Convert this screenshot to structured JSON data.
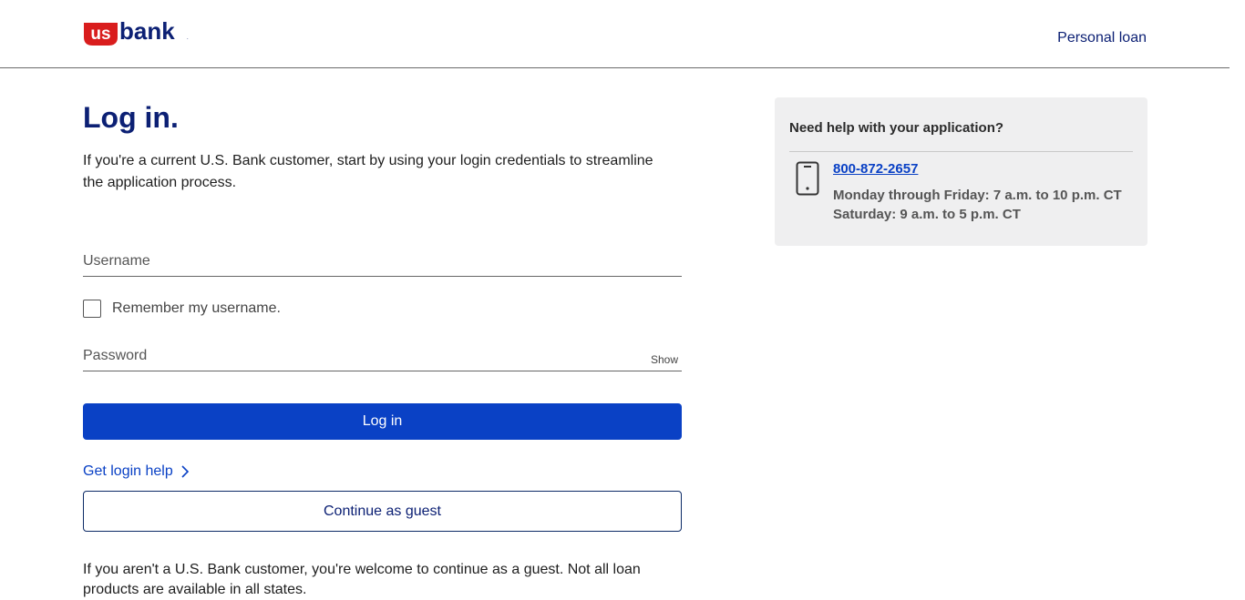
{
  "header": {
    "logo_text": "usbank",
    "nav_link": "Personal loan",
    "colors": {
      "brand_red": "#d91d1d",
      "brand_navy": "#0c2074"
    }
  },
  "main": {
    "title": "Log in.",
    "intro": "If you're a current U.S. Bank customer, start by using your login credentials to streamline the application process.",
    "username_label": "Username",
    "remember_label": "Remember my username.",
    "password_label": "Password",
    "show_label": "Show",
    "login_button": "Log in",
    "help_link": "Get login help",
    "guest_button": "Continue as guest",
    "guest_note": "If you aren't a U.S. Bank customer, you're welcome to continue as a guest. Not all loan products are available in all states.",
    "colors": {
      "button_blue": "#0a41c5"
    }
  },
  "help_card": {
    "title": "Need help with your application?",
    "phone_icon": "mobile-phone-icon",
    "phone": "800-872-2657",
    "hours_weekday": "Monday through Friday: 7 a.m. to 10 p.m. CT",
    "hours_saturday": "Saturday: 9 a.m. to 5 p.m. CT"
  }
}
